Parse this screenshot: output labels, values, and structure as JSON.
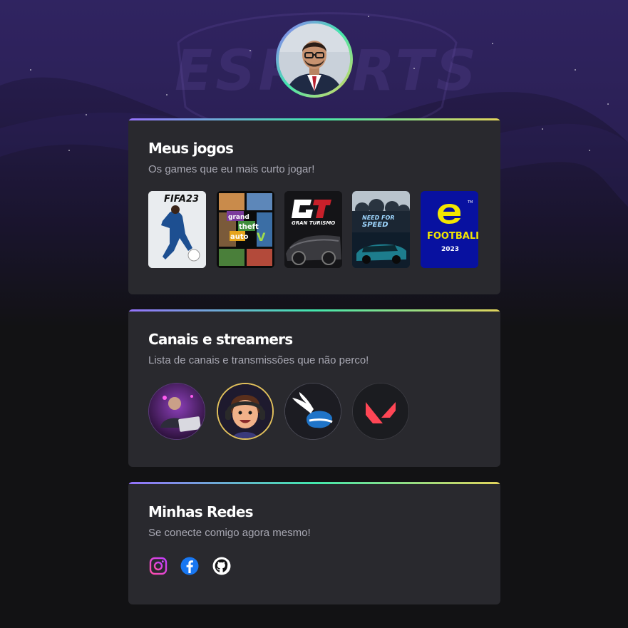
{
  "background": {
    "watermark": "ESPORTS"
  },
  "profile": {
    "avatar_icon": "profile-photo"
  },
  "games_card": {
    "title": "Meus jogos",
    "subtitle": "Os games que eu mais curto jogar!",
    "games": [
      {
        "cover_text": "FIFA23"
      },
      {
        "cover_text": "grand theft auto"
      },
      {
        "cover_text": "GRAN TURISMO"
      },
      {
        "cover_text": "NEED FOR SPEED"
      },
      {
        "cover_text": "FOOTBALL",
        "cover_year": "2023"
      }
    ]
  },
  "channels_card": {
    "title": "Canais e streamers",
    "subtitle": "Lista de canais e transmissões que não perco!"
  },
  "social_card": {
    "title": "Minhas Redes",
    "subtitle": "Se conecte comigo agora mesmo!",
    "links": [
      "instagram-icon",
      "facebook-icon",
      "github-icon"
    ]
  },
  "colors": {
    "gradient_start": "#9572fc",
    "gradient_mid": "#43e7ad",
    "gradient_end": "#e2d45c",
    "card_bg": "#29292e",
    "page_bg": "#121214"
  }
}
